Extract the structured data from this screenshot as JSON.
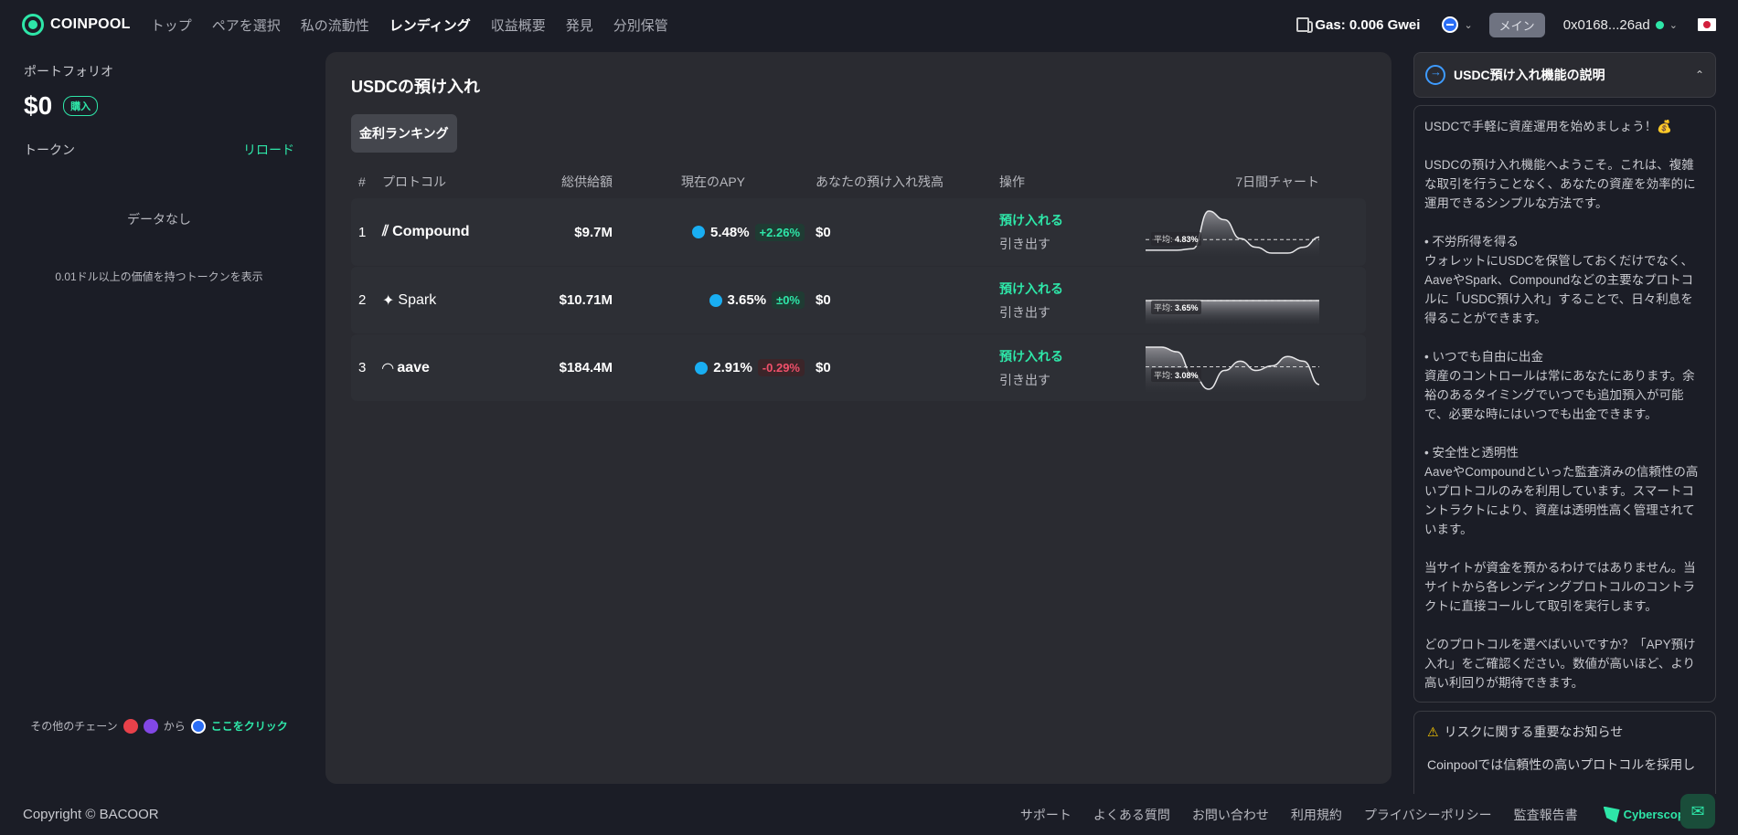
{
  "header": {
    "logo_text": "COINPOOL",
    "nav": [
      {
        "label": "トップ",
        "active": false
      },
      {
        "label": "ペアを選択",
        "active": false
      },
      {
        "label": "私の流動性",
        "active": false
      },
      {
        "label": "レンディング",
        "active": true
      },
      {
        "label": "収益概要",
        "active": false
      },
      {
        "label": "発見",
        "active": false
      },
      {
        "label": "分別保管",
        "active": false
      }
    ],
    "gas": "Gas: 0.006 Gwei",
    "network_badge": "メイン",
    "wallet": "0x0168...26ad"
  },
  "sidebar": {
    "portfolio_label": "ポートフォリオ",
    "balance": "$0",
    "buy_label": "購入",
    "token_label": "トークン",
    "reload_label": "リロード",
    "no_data": "データなし",
    "filter_note": "0.01ドル以上の価値を持つトークンを表示",
    "other_chains_prefix": "その他のチェーン",
    "other_chains_from": "から",
    "click_here": "ここをクリック"
  },
  "main": {
    "title": "USDCの預け入れ",
    "tab_label": "金利ランキング",
    "columns": {
      "idx": "#",
      "protocol": "プロトコル",
      "tvl": "総供給額",
      "apy": "現在のAPY",
      "balance": "あなたの預け入れ残高",
      "action": "操作",
      "chart": "7日間チャート"
    },
    "rows": [
      {
        "idx": "1",
        "protocol": "Compound",
        "tvl": "$9.7M",
        "apy": "5.48%",
        "change": "+2.26%",
        "change_type": "pos",
        "balance": "$0",
        "deposit": "預け入れる",
        "withdraw": "引き出す",
        "avg_label": "平均:",
        "avg": "4.83%",
        "series": [
          4.1,
          4.1,
          4.1,
          4.2,
          6.8,
          6.2,
          4.9,
          4.3,
          3.9,
          3.9,
          4.3,
          5.0
        ]
      },
      {
        "idx": "2",
        "protocol": "Spark",
        "tvl": "$10.71M",
        "apy": "3.65%",
        "change": "±0%",
        "change_type": "pos",
        "balance": "$0",
        "deposit": "預け入れる",
        "withdraw": "引き出す",
        "avg_label": "平均:",
        "avg": "3.65%",
        "series": [
          3.65,
          3.65,
          3.65,
          3.65,
          3.65,
          3.65,
          3.65,
          3.65,
          3.65,
          3.65,
          3.65,
          3.65
        ]
      },
      {
        "idx": "3",
        "protocol": "aave",
        "tvl": "$184.4M",
        "apy": "2.91%",
        "change": "-0.29%",
        "change_type": "neg",
        "balance": "$0",
        "deposit": "預け入れる",
        "withdraw": "引き出す",
        "avg_label": "平均:",
        "avg": "3.08%",
        "series": [
          3.5,
          3.5,
          3.4,
          2.9,
          2.6,
          3.0,
          3.2,
          3.0,
          3.1,
          3.3,
          3.2,
          2.7
        ]
      }
    ]
  },
  "info": {
    "title": "USDC預け入れ機能の説明",
    "paragraphs": [
      "USDCで手軽に資産運用を始めましょう！💰",
      "",
      "USDCの預け入れ機能へようこそ。これは、複雑な取引を行うことなく、あなたの資産を効率的に運用できるシンプルな方法です。",
      "",
      "• 不労所得を得る",
      "ウォレットにUSDCを保管しておくだけでなく、AaveやSpark、Compoundなどの主要なプロトコルに「USDC預け入れ」することで、日々利息を得ることができます。",
      "",
      "• いつでも自由に出金",
      "資産のコントロールは常にあなたにあります。余裕のあるタイミングでいつでも追加預入が可能で、必要な時にはいつでも出金できます。",
      "",
      "• 安全性と透明性",
      "AaveやCompoundといった監査済みの信頼性の高いプロトコルのみを利用しています。スマートコントラクトにより、資産は透明性高く管理されています。",
      "",
      "当サイトが資金を預かるわけではありません。当サイトから各レンディングプロトコルのコントラクトに直接コールして取引を実行します。",
      "",
      "どのプロトコルを選べばいいですか？「APY預け入れ」をご確認ください。数値が高いほど、より高い利回りが期待できます。"
    ],
    "risk_title": "リスクに関する重要なお知らせ",
    "risk_text": "Coinpoolでは信頼性の高いプロトコルを採用し"
  },
  "footer": {
    "copyright": "Copyright © BACOOR",
    "links": [
      "サポート",
      "よくある質問",
      "お問い合わせ",
      "利用規約",
      "プライバシーポリシー",
      "監査報告書"
    ],
    "partner": "Cyberscope"
  },
  "colors": {
    "accent": "#2ee6a8",
    "negative": "#f0506a",
    "usdc": "#19aef2",
    "panel": "#2a2b31",
    "bg": "#1b1d26"
  }
}
